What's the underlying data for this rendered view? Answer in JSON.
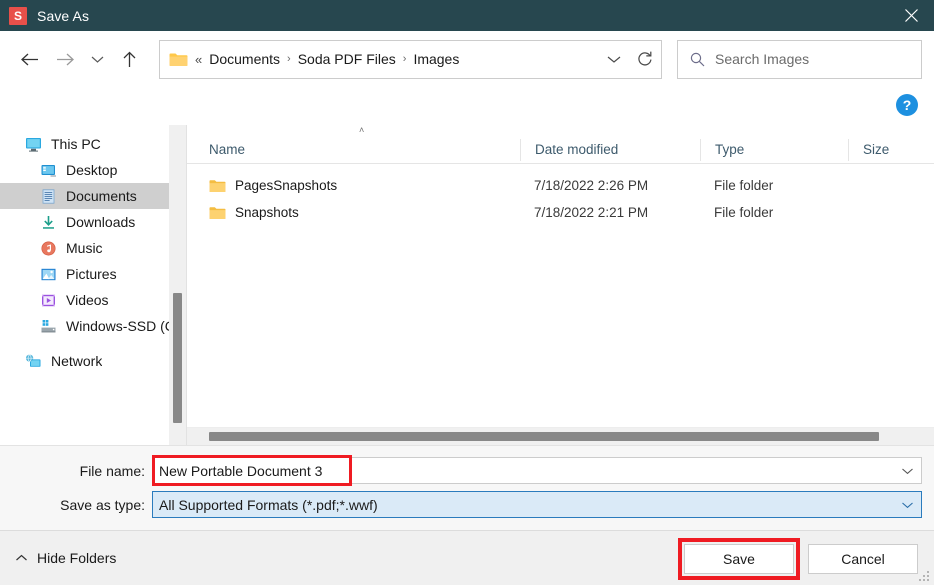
{
  "titlebar": {
    "app_icon_letter": "S",
    "title": "Save As",
    "close_label": "Close",
    "bg_color": "#27474F",
    "icon_color": "#E8504A"
  },
  "nav": {
    "back": "Back",
    "forward": "Forward",
    "recent": "Recent locations",
    "up": "Up"
  },
  "address": {
    "overflow_chevrons": "«",
    "crumbs": [
      "Documents",
      "Soda PDF Files",
      "Images"
    ],
    "separator": "›",
    "dropdown": "Previous locations",
    "refresh": "Refresh"
  },
  "search": {
    "placeholder": "Search Images",
    "icon": "search-icon"
  },
  "help": {
    "label": "?"
  },
  "sidebar": {
    "items": [
      {
        "label": "This PC",
        "icon": "monitor-icon",
        "level": 0,
        "selected": false
      },
      {
        "label": "Desktop",
        "icon": "desktop-icon",
        "level": 1,
        "selected": false
      },
      {
        "label": "Documents",
        "icon": "documents-icon",
        "level": 1,
        "selected": true
      },
      {
        "label": "Downloads",
        "icon": "downloads-icon",
        "level": 1,
        "selected": false
      },
      {
        "label": "Music",
        "icon": "music-icon",
        "level": 1,
        "selected": false
      },
      {
        "label": "Pictures",
        "icon": "pictures-icon",
        "level": 1,
        "selected": false
      },
      {
        "label": "Videos",
        "icon": "videos-icon",
        "level": 1,
        "selected": false
      },
      {
        "label": "Windows-SSD (C",
        "icon": "drive-icon",
        "level": 1,
        "selected": false
      },
      {
        "label": "Network",
        "icon": "network-icon",
        "level": 0,
        "selected": false
      }
    ]
  },
  "filelist": {
    "columns": [
      "Name",
      "Date modified",
      "Type",
      "Size"
    ],
    "sort_indicator": "˄",
    "rows": [
      {
        "name": "PagesSnapshots",
        "date": "7/18/2022 2:26 PM",
        "type": "File folder",
        "size": ""
      },
      {
        "name": "Snapshots",
        "date": "7/18/2022 2:21 PM",
        "type": "File folder",
        "size": ""
      }
    ]
  },
  "form": {
    "filename_label": "File name:",
    "filename_value": "New Portable Document 3",
    "savetype_label": "Save as type:",
    "savetype_value": "All Supported Formats (*.pdf;*.wwf)",
    "dropdown_glyph": "∨"
  },
  "footer": {
    "hide_folders": "Hide Folders",
    "hide_folders_glyph": "˄",
    "save": "Save",
    "cancel": "Cancel"
  },
  "annotations": {
    "color": "#EF1B22",
    "targets": [
      "filename-field",
      "save-button"
    ]
  }
}
